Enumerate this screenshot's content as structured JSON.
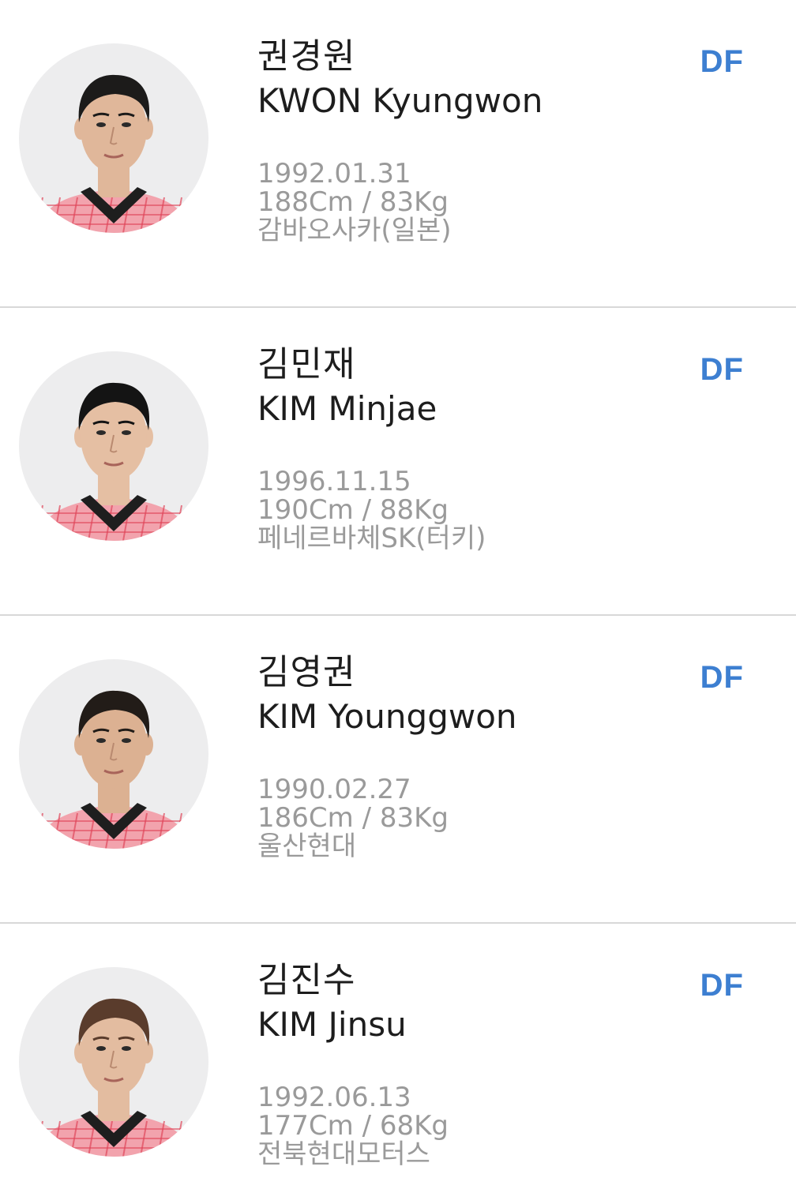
{
  "players": [
    {
      "name_ko": "권경원",
      "name_en": "KWON Kyungwon",
      "position": "DF",
      "birth": "1992.01.31",
      "body": "188Cm / 83Kg",
      "club": "감바오사카(일본)",
      "hair_color": "#1c1b1a",
      "skin_color": "#e0b79a"
    },
    {
      "name_ko": "김민재",
      "name_en": "KIM Minjae",
      "position": "DF",
      "birth": "1996.11.15",
      "body": "190Cm / 88Kg",
      "club": "페네르바체SK(터키)",
      "hair_color": "#141414",
      "skin_color": "#e5bfa3"
    },
    {
      "name_ko": "김영권",
      "name_en": "KIM Younggwon",
      "position": "DF",
      "birth": "1990.02.27",
      "body": "186Cm / 83Kg",
      "club": "울산현대",
      "hair_color": "#221c18",
      "skin_color": "#dcb192"
    },
    {
      "name_ko": "김진수",
      "name_en": "KIM Jinsu",
      "position": "DF",
      "birth": "1992.06.13",
      "body": "177Cm / 68Kg",
      "club": "전북현대모터스",
      "hair_color": "#5a3c2c",
      "skin_color": "#e3bca0"
    }
  ],
  "colors": {
    "position": "#3d7fd1",
    "detail_text": "#9a9a9a",
    "divider": "#d8d8d8",
    "jersey": "#f2a3ad",
    "jersey_line": "#e0465a",
    "collar": "#1e1e1e"
  }
}
